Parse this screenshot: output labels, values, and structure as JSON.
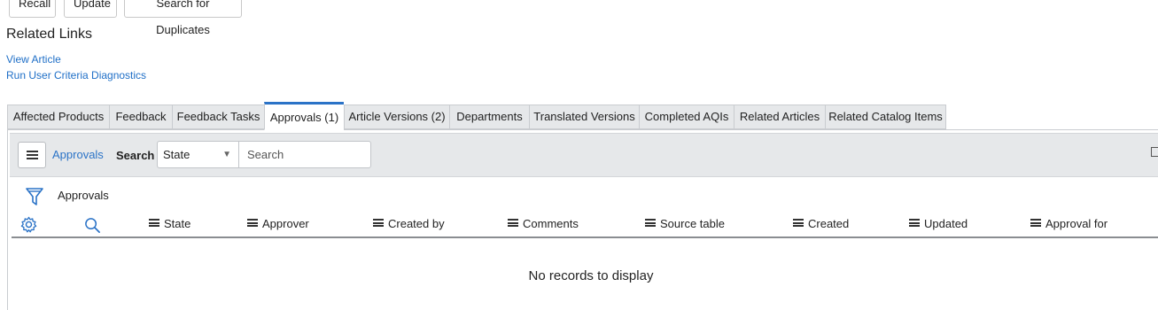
{
  "form_buttons": {
    "recall": "Recall",
    "update": "Update",
    "search_duplicates": "Search for Duplicates"
  },
  "related_links": {
    "title": "Related Links",
    "links": [
      "View Article",
      "Run User Criteria Diagnostics"
    ]
  },
  "tabs": [
    {
      "label": "Affected Products"
    },
    {
      "label": "Feedback"
    },
    {
      "label": "Feedback Tasks"
    },
    {
      "label": "Approvals (1)",
      "active": true
    },
    {
      "label": "Article Versions (2)"
    },
    {
      "label": "Departments"
    },
    {
      "label": "Translated Versions"
    },
    {
      "label": "Completed AQIs"
    },
    {
      "label": "Related Articles"
    },
    {
      "label": "Related Catalog Items"
    }
  ],
  "list": {
    "title": "Approvals",
    "search_label": "Search",
    "search_field": "State",
    "search_placeholder": "Search",
    "breadcrumb": "Approvals",
    "columns": [
      "State",
      "Approver",
      "Created by",
      "Comments",
      "Source table",
      "Created",
      "Updated",
      "Approval for"
    ],
    "empty_message": "No records to display"
  },
  "icons": {
    "menu": "hamburger-menu-icon",
    "filter": "filter-icon",
    "personalize": "gear-icon",
    "search": "search-icon",
    "collapse": "collapse-icon",
    "sort": "column-menu-icon"
  },
  "colors": {
    "link": "#1f6fc7",
    "active_tab": "#2b73c7",
    "toolbar_bg": "#e6e8ea"
  }
}
